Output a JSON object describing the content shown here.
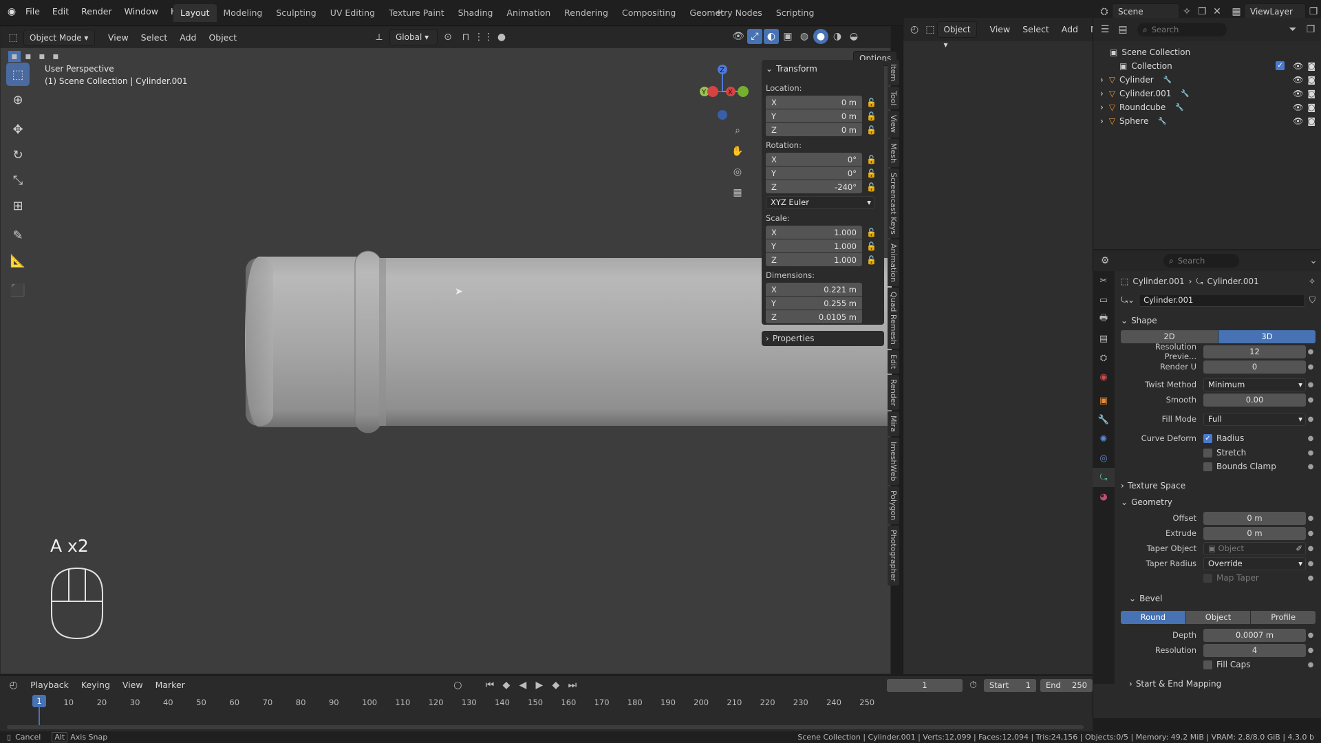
{
  "menu": [
    "File",
    "Edit",
    "Render",
    "Window",
    "Help"
  ],
  "workspaces": [
    "Layout",
    "Modeling",
    "Sculpting",
    "UV Editing",
    "Texture Paint",
    "Shading",
    "Animation",
    "Rendering",
    "Compositing",
    "Geometry Nodes",
    "Scripting"
  ],
  "active_workspace": "Layout",
  "scene_name": "Scene",
  "view_layer": "ViewLayer",
  "viewport_header": {
    "mode": "Object Mode",
    "menus": [
      "View",
      "Select",
      "Add",
      "Object"
    ],
    "transform_orientation": "Global",
    "options": "Options"
  },
  "viewport_info": {
    "perspective": "User Perspective",
    "collection": "(1) Scene Collection | Cylinder.001"
  },
  "key_overlay": "A x2",
  "transform": {
    "title": "Transform",
    "location_label": "Location:",
    "location": [
      {
        "axis": "X",
        "value": "0 m"
      },
      {
        "axis": "Y",
        "value": "0 m"
      },
      {
        "axis": "Z",
        "value": "0 m"
      }
    ],
    "rotation_label": "Rotation:",
    "rotation": [
      {
        "axis": "X",
        "value": "0°"
      },
      {
        "axis": "Y",
        "value": "0°"
      },
      {
        "axis": "Z",
        "value": "-240°"
      }
    ],
    "rotation_mode": "XYZ Euler",
    "scale_label": "Scale:",
    "scale": [
      {
        "axis": "X",
        "value": "1.000"
      },
      {
        "axis": "Y",
        "value": "1.000"
      },
      {
        "axis": "Z",
        "value": "1.000"
      }
    ],
    "dimensions_label": "Dimensions:",
    "dimensions": [
      {
        "axis": "X",
        "value": "0.221 m"
      },
      {
        "axis": "Y",
        "value": "0.255 m"
      },
      {
        "axis": "Z",
        "value": "0.0105 m"
      }
    ],
    "properties": "Properties"
  },
  "sidebar_tabs": [
    "Item",
    "Tool",
    "View",
    "Mesh",
    "Screencast Keys",
    "Animation",
    "Quad Remesh",
    "Edit",
    "Render",
    "Mira",
    "ImeshWeb",
    "Polygon",
    "Photographer"
  ],
  "outliner": {
    "header_object": "Object",
    "header_menus": [
      "View",
      "Select",
      "Add",
      "No"
    ],
    "search_placeholder": "Search",
    "scene_collection": "Scene Collection",
    "collection": "Collection",
    "objects": [
      "Cylinder",
      "Cylinder.001",
      "Roundcube",
      "Sphere"
    ]
  },
  "properties": {
    "search_placeholder": "Search",
    "breadcrumb_object": "Cylinder.001",
    "breadcrumb_data": "Cylinder.001",
    "datablock": "Cylinder.001",
    "shape": {
      "title": "Shape",
      "dim_2d": "2D",
      "dim_3d": "3D",
      "resolution_preview_label": "Resolution Previe...",
      "resolution_preview": "12",
      "render_u_label": "Render U",
      "render_u": "0",
      "twist_method_label": "Twist Method",
      "twist_method": "Minimum",
      "smooth_label": "Smooth",
      "smooth": "0.00",
      "fill_mode_label": "Fill Mode",
      "fill_mode": "Full",
      "curve_deform_label": "Curve Deform",
      "radius": "Radius",
      "stretch": "Stretch",
      "bounds_clamp": "Bounds Clamp"
    },
    "texture_space": "Texture Space",
    "geometry": {
      "title": "Geometry",
      "offset_label": "Offset",
      "offset": "0 m",
      "extrude_label": "Extrude",
      "extrude": "0 m",
      "taper_object_label": "Taper Object",
      "taper_object_placeholder": "Object",
      "taper_radius_label": "Taper Radius",
      "taper_radius": "Override",
      "map_taper": "Map Taper"
    },
    "bevel": {
      "title": "Bevel",
      "modes": [
        "Round",
        "Object",
        "Profile"
      ],
      "depth_label": "Depth",
      "depth": "0.0007 m",
      "resolution_label": "Resolution",
      "resolution": "4",
      "fill_caps": "Fill Caps"
    },
    "start_end_mapping": "Start & End Mapping"
  },
  "timeline": {
    "menus": [
      "Playback",
      "Keying",
      "View",
      "Marker"
    ],
    "current_frame": "1",
    "start_label": "Start",
    "start": "1",
    "end_label": "End",
    "end": "250",
    "ticks": [
      "10",
      "20",
      "30",
      "40",
      "50",
      "60",
      "70",
      "80",
      "90",
      "100",
      "110",
      "120",
      "130",
      "140",
      "150",
      "160",
      "170",
      "180",
      "190",
      "200",
      "210",
      "220",
      "230",
      "240",
      "250"
    ],
    "playhead": "1"
  },
  "status": {
    "cancel": "Cancel",
    "alt": "Alt",
    "axis_snap": "Axis Snap",
    "stats": "Scene Collection | Cylinder.001 | Verts:12,099 | Faces:12,094 | Tris:24,156 | Objects:0/5 | Memory: 49.2 MiB | VRAM: 2.8/8.0 GiB | 4.3.0 b"
  }
}
